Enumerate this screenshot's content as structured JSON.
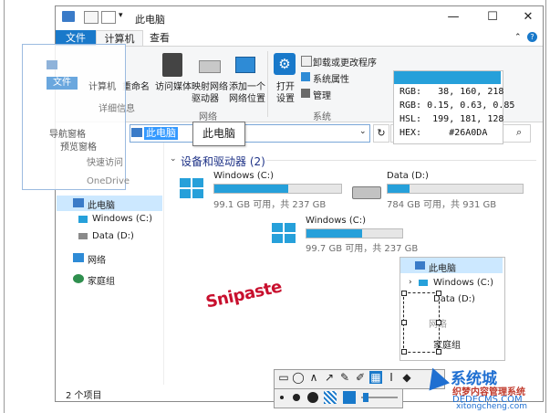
{
  "window": {
    "title": "此电脑",
    "controls": [
      "—",
      "☐",
      "✕"
    ]
  },
  "ribbon": {
    "tabs": [
      "文件",
      "计算机",
      "查看"
    ],
    "items": {
      "rename": "重命名",
      "media": "访问媒体",
      "map_drive_1": "映射网络",
      "map_drive_2": "驱动器",
      "add_location_1": "添加一个",
      "add_location_2": "网络位置",
      "open_settings_1": "打开",
      "open_settings_2": "设置",
      "uninstall": "卸载或更改程序",
      "sys_props": "系统属性",
      "manage": "管理"
    },
    "groups": {
      "network": "网络",
      "system": "系统"
    }
  },
  "address": {
    "path": "此电脑"
  },
  "tooltip": {
    "text": "此电脑"
  },
  "nav": {
    "items": [
      "此电脑",
      "Windows (C:)",
      "Data (D:)",
      "网络",
      "家庭组"
    ],
    "ghost_items": [
      "计算机",
      "文件",
      "导航窗格",
      "预览窗格",
      "详细信息",
      "快速访问",
      "OneDrive"
    ]
  },
  "content": {
    "section_title": "设备和驱动器 (2)",
    "drives": [
      {
        "name": "Windows (C:)",
        "info": "99.1 GB 可用，共 237 GB",
        "used": 0.58
      },
      {
        "name": "Data (D:)",
        "info": "784 GB 可用，共 931 GB",
        "used": 0.16
      },
      {
        "name": "Windows (C:)",
        "info": "99.7 GB 可用，共 237 GB",
        "used": 0.58
      }
    ]
  },
  "status": {
    "count": "2 个项目"
  },
  "color_picker": {
    "swatch": "#26A0DA",
    "rows": [
      {
        "label": "RGB:",
        "value": "38, 160, 218"
      },
      {
        "label": "RGB:",
        "value": "0.15, 0.63, 0.85"
      },
      {
        "label": "HSL:",
        "value": "199, 181, 128"
      },
      {
        "label": "HEX:",
        "value": "#26A0DA"
      }
    ]
  },
  "snipaste": {
    "label": "Snipaste"
  },
  "mini_panel": {
    "items": [
      "此电脑",
      "Windows (C:)",
      "Data (D:)",
      "网络",
      "家庭组"
    ]
  },
  "watermark": {
    "title": "系统城",
    "sub": "织梦内容管理系统",
    "url": "DEDECMS.COM",
    "url2": "xitongcheng.com"
  },
  "colors": {
    "accent": "#26A0DA",
    "file_tab": "#1979CA",
    "selection": "#CCE8FF"
  }
}
